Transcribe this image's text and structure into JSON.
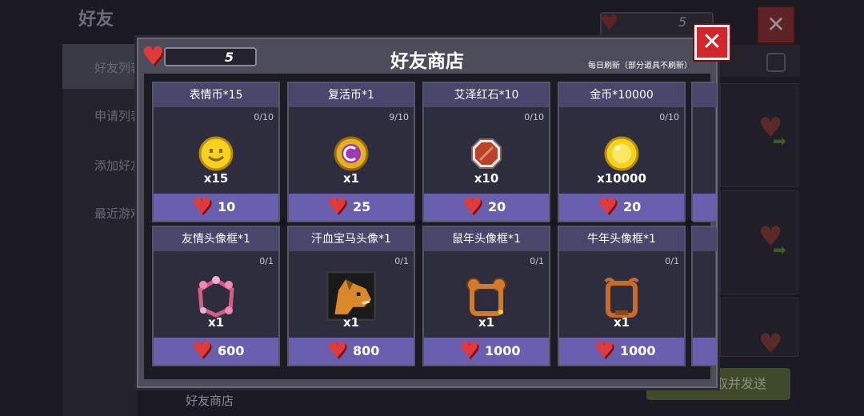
{
  "background": {
    "title": "好友",
    "sidebar": [
      "好友列表",
      "申请列表",
      "添加好友",
      "最近游戏"
    ],
    "hearts": "5",
    "send_button": "一键领取并发送",
    "bottom_label": "好友商店",
    "close_icon": "✕"
  },
  "shop": {
    "title": "好友商店",
    "hearts": "5",
    "refresh_note": "每日刷新（部分道具不刷新）",
    "close_icon": "✕",
    "items": [
      {
        "name": "表情币*15",
        "stock": "0/10",
        "qty": "x15",
        "price": "10",
        "icon": "smiley-coin-icon"
      },
      {
        "name": "复活币*1",
        "stock": "9/10",
        "qty": "x1",
        "price": "25",
        "icon": "revive-coin-icon"
      },
      {
        "name": "艾泽红石*10",
        "stock": "0/10",
        "qty": "x10",
        "price": "20",
        "icon": "red-stone-icon"
      },
      {
        "name": "金币*10000",
        "stock": "0/10",
        "qty": "x10000",
        "price": "20",
        "icon": "gold-coin-icon"
      },
      {
        "name": "友情头像框*1",
        "stock": "0/1",
        "qty": "x1",
        "price": "600",
        "icon": "flower-frame-icon"
      },
      {
        "name": "汗血宝马头像*1",
        "stock": "0/1",
        "qty": "x1",
        "price": "800",
        "icon": "horse-avatar-icon"
      },
      {
        "name": "鼠年头像框*1",
        "stock": "0/1",
        "qty": "x1",
        "price": "1000",
        "icon": "rat-frame-icon"
      },
      {
        "name": "牛年头像框*1",
        "stock": "0/1",
        "qty": "x1",
        "price": "1000",
        "icon": "ox-frame-icon"
      }
    ]
  },
  "colors": {
    "heart": "#e23a3a",
    "price_bar": "#6a5fae",
    "close": "#d0262c"
  }
}
